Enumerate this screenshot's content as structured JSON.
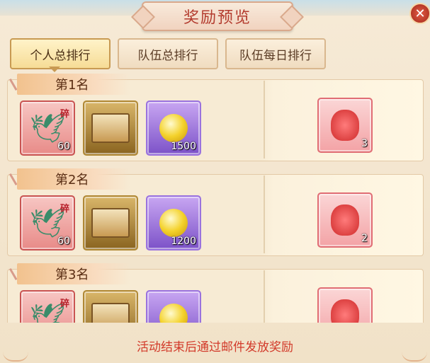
{
  "window": {
    "title": "奖励预览",
    "close_icon": "close-icon"
  },
  "tabs": [
    {
      "label": "个人总排行",
      "active": true
    },
    {
      "label": "队伍总排行",
      "active": false
    },
    {
      "label": "队伍每日排行",
      "active": false
    }
  ],
  "ranks": [
    {
      "label": "第1名",
      "items": [
        {
          "icon": "kite-fragment-icon",
          "badge": "碎",
          "qty": "60"
        },
        {
          "icon": "treasure-box-icon",
          "qty": ""
        },
        {
          "icon": "gold-orb-icon",
          "qty": "1500"
        }
      ],
      "reward": {
        "icon": "lucky-bag-icon",
        "qty": "3"
      }
    },
    {
      "label": "第2名",
      "items": [
        {
          "icon": "kite-fragment-icon",
          "badge": "碎",
          "qty": "60"
        },
        {
          "icon": "treasure-box-icon",
          "qty": ""
        },
        {
          "icon": "gold-orb-icon",
          "qty": "1200"
        }
      ],
      "reward": {
        "icon": "lucky-bag-icon",
        "qty": "2"
      }
    },
    {
      "label": "第3名",
      "items": [
        {
          "icon": "kite-fragment-icon",
          "badge": "碎",
          "qty": ""
        },
        {
          "icon": "treasure-box-icon",
          "qty": ""
        },
        {
          "icon": "gold-orb-icon",
          "qty": ""
        }
      ],
      "reward": {
        "icon": "lucky-bag-icon",
        "qty": ""
      }
    }
  ],
  "footer": {
    "note": "活动结束后通过邮件发放奖励"
  },
  "colors": {
    "title": "#b33b2e",
    "note": "#d23a2a",
    "accent": "#c89a52"
  }
}
